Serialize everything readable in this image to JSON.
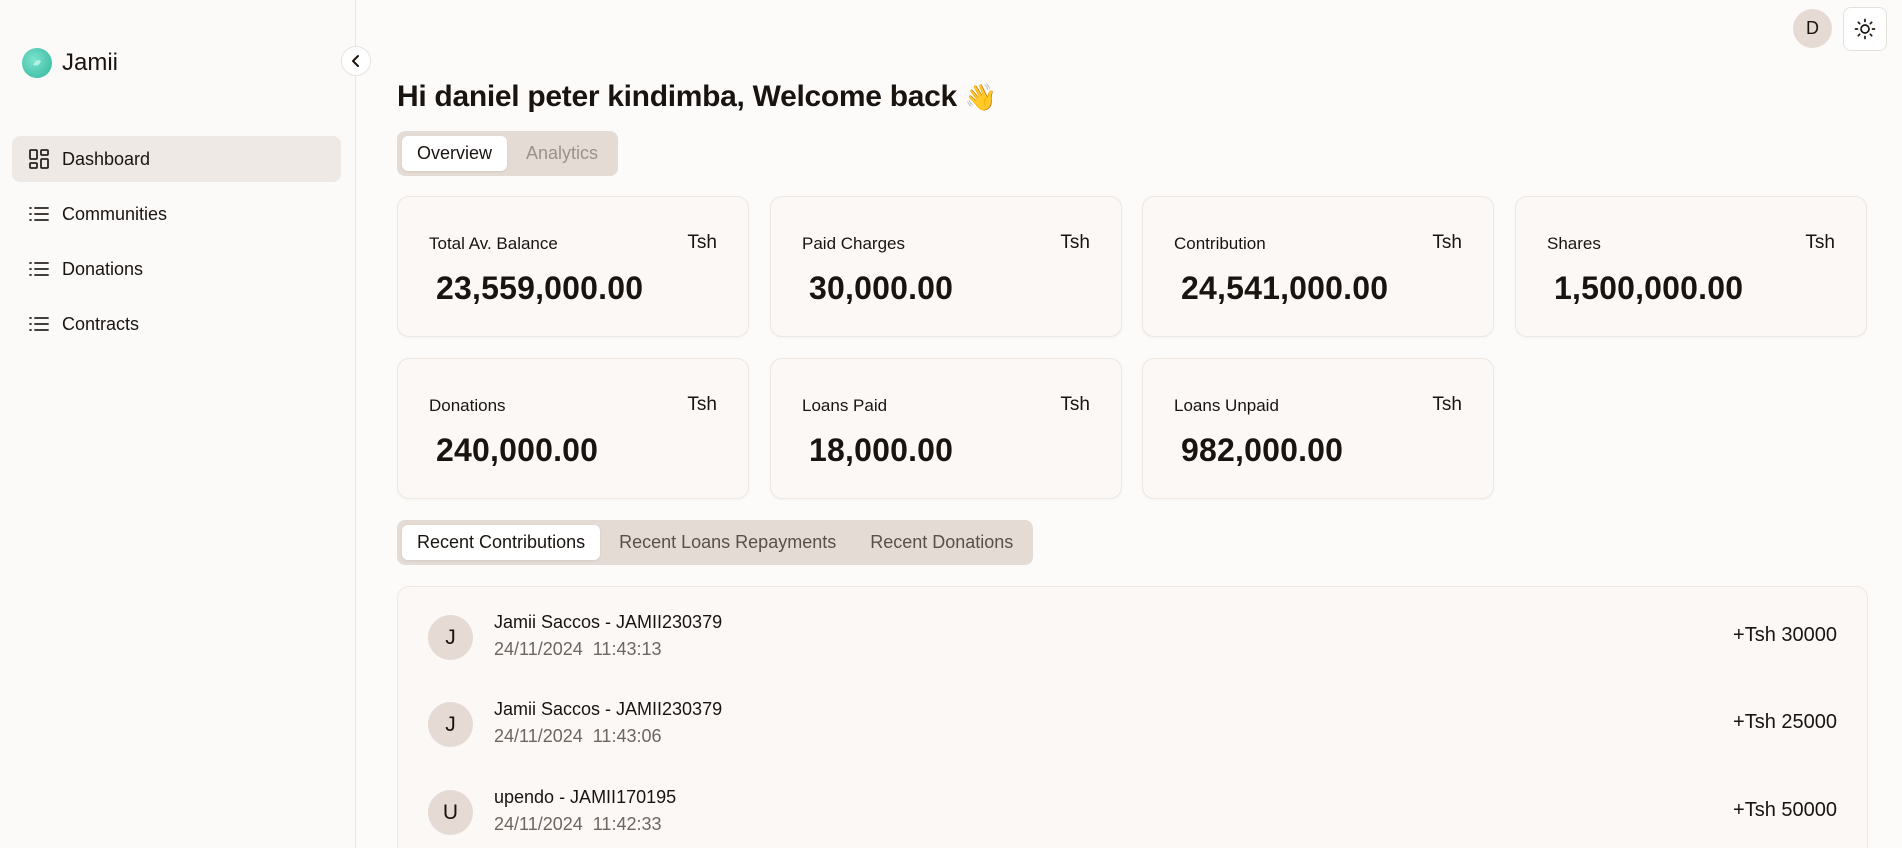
{
  "brand": {
    "name": "Jamii"
  },
  "sidebar": {
    "items": [
      {
        "label": "Dashboard"
      },
      {
        "label": "Communities"
      },
      {
        "label": "Donations"
      },
      {
        "label": "Contracts"
      }
    ]
  },
  "header": {
    "avatar_initial": "D"
  },
  "main": {
    "greeting": "Hi daniel peter kindimba, Welcome back",
    "greeting_emoji": "👋",
    "tabs": [
      {
        "label": "Overview"
      },
      {
        "label": "Analytics"
      }
    ],
    "cards": [
      {
        "label": "Total Av. Balance",
        "currency": "Tsh",
        "value": "23,559,000.00"
      },
      {
        "label": "Paid Charges",
        "currency": "Tsh",
        "value": "30,000.00"
      },
      {
        "label": "Contribution",
        "currency": "Tsh",
        "value": "24,541,000.00"
      },
      {
        "label": "Shares",
        "currency": "Tsh",
        "value": "1,500,000.00"
      },
      {
        "label": "Donations",
        "currency": "Tsh",
        "value": "240,000.00"
      },
      {
        "label": "Loans Paid",
        "currency": "Tsh",
        "value": "18,000.00"
      },
      {
        "label": "Loans Unpaid",
        "currency": "Tsh",
        "value": "982,000.00"
      }
    ],
    "recent_tabs": [
      {
        "label": "Recent Contributions"
      },
      {
        "label": "Recent Loans Repayments"
      },
      {
        "label": "Recent Donations"
      }
    ],
    "recent": [
      {
        "initial": "J",
        "title": "Jamii Saccos - JAMII230379",
        "date": "24/11/2024  11:43:13",
        "amount": "+Tsh 30000"
      },
      {
        "initial": "J",
        "title": "Jamii Saccos - JAMII230379",
        "date": "24/11/2024  11:43:06",
        "amount": "+Tsh 25000"
      },
      {
        "initial": "U",
        "title": "upendo - JAMII170195",
        "date": "24/11/2024  11:42:33",
        "amount": "+Tsh 50000"
      }
    ]
  }
}
